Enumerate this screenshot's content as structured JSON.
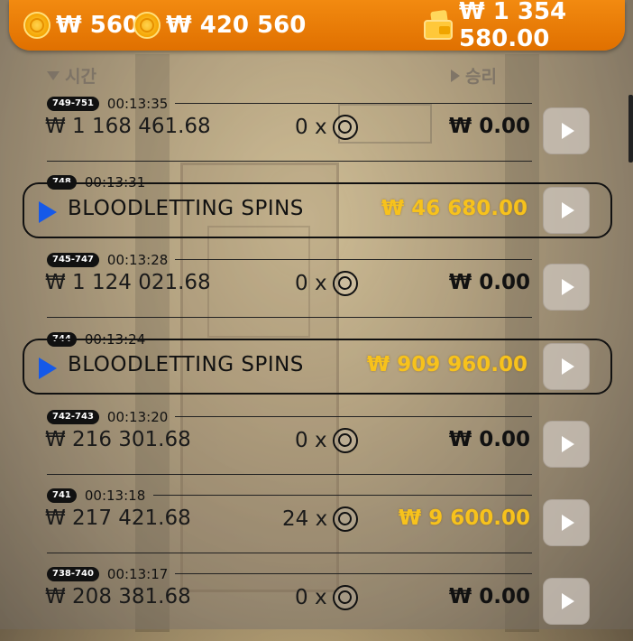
{
  "topbar": {
    "coins_small": "₩ 560",
    "coins_total": "₩ 420 560",
    "balance": "₩ 1 354 580.00"
  },
  "columns": {
    "time": "시간",
    "win": "승리"
  },
  "rows": [
    {
      "type": "bet",
      "badge": "749-751",
      "time": "00:13:35",
      "bet": "₩ 1 168 461.68",
      "count": "0 x",
      "win": "₩ 0.00"
    },
    {
      "type": "feature",
      "badge": "748",
      "time": "00:13:31",
      "label": "BLOODLETTING SPINS",
      "win": "₩ 46 680.00"
    },
    {
      "type": "bet",
      "badge": "745-747",
      "time": "00:13:28",
      "bet": "₩ 1 124 021.68",
      "count": "0 x",
      "win": "₩ 0.00"
    },
    {
      "type": "feature",
      "badge": "744",
      "time": "00:13:24",
      "label": "BLOODLETTING SPINS",
      "win": "₩ 909 960.00"
    },
    {
      "type": "bet",
      "badge": "742-743",
      "time": "00:13:20",
      "bet": "₩ 216 301.68",
      "count": "0 x",
      "win": "₩ 0.00"
    },
    {
      "type": "bet",
      "badge": "741",
      "time": "00:13:18",
      "bet": "₩ 217 421.68",
      "count": "24 x",
      "win": "₩ 9 600.00"
    },
    {
      "type": "bet",
      "badge": "738-740",
      "time": "00:13:17",
      "bet": "₩ 208 381.68",
      "count": "0 x",
      "win": "₩ 0.00"
    }
  ],
  "colors": {
    "accent": "#f28a10",
    "gold": "#f7c21c",
    "feature_arrow": "#1559e8"
  }
}
